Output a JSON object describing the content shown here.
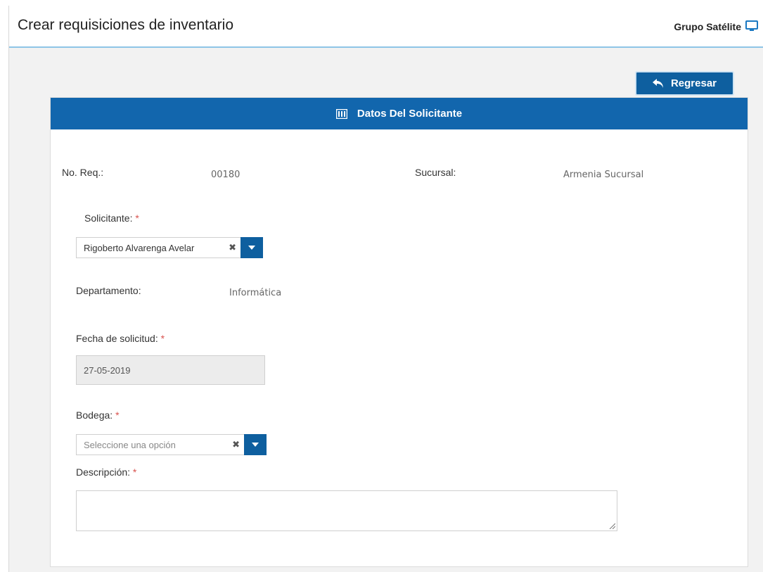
{
  "header": {
    "title": "Crear requisiciones de inventario",
    "company": "Grupo Satélite",
    "icon": "monitor-icon"
  },
  "toolbar": {
    "back_label": "Regresar",
    "back_icon": "reply-arrow-icon"
  },
  "panel": {
    "title": "Datos Del Solicitante",
    "icon": "form-icon",
    "accent": "#1266ad"
  },
  "form": {
    "req_label": "No. Req.:",
    "req_value": "00180",
    "branch_label": "Sucursal:",
    "branch_value": "Armenia Sucursal",
    "requester_label": "Solicitante:",
    "requester_value": "Rigoberto Alvarenga Avelar",
    "department_label": "Departamento:",
    "department_value": "Informática",
    "date_label": "Fecha de solicitud:",
    "date_value": "27-05-2019",
    "warehouse_label": "Bodega:",
    "warehouse_placeholder": "Seleccione una opción",
    "description_label": "Descripción:",
    "description_value": "",
    "required_mark": "*"
  }
}
